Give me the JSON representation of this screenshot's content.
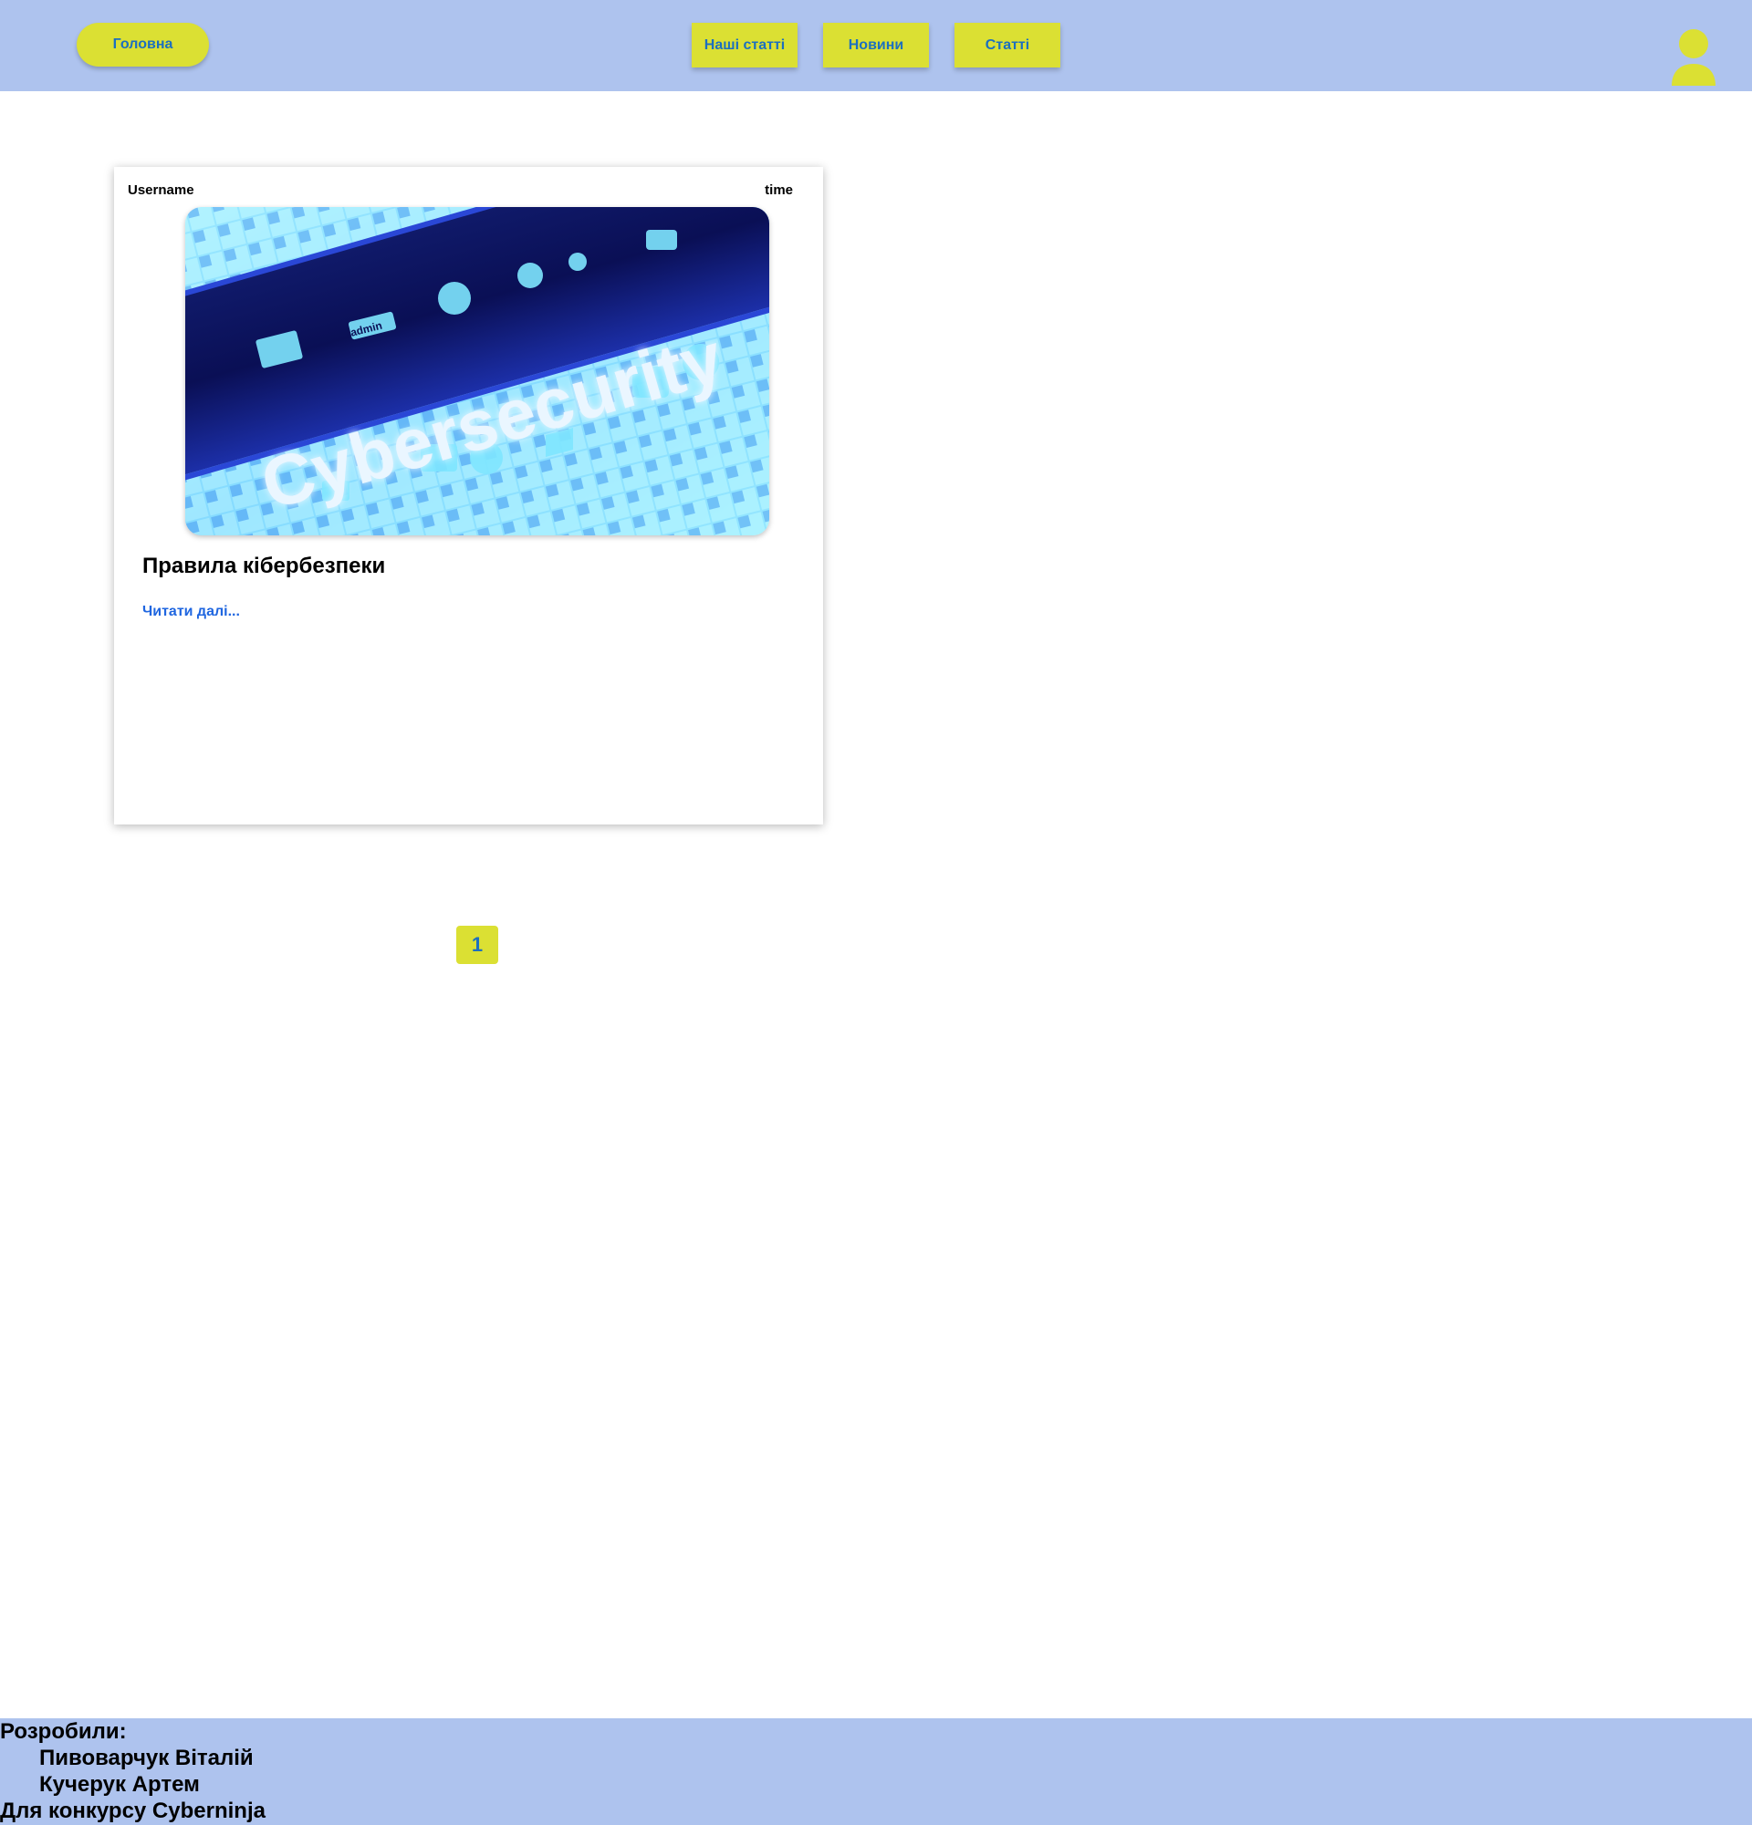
{
  "header": {
    "home_label": "Головна",
    "nav": [
      "Наші статті",
      "Новини",
      "Статті"
    ],
    "user_icon": "user-avatar-icon"
  },
  "article": {
    "username": "Username",
    "time": "time",
    "image_text": "Cybersecurity",
    "image_small_text": "admin",
    "title": "Правила кібербезпеки",
    "read_more": "Читати далі..."
  },
  "pagination": {
    "current_page": "1"
  },
  "footer": {
    "developed_by": "Розробили:",
    "authors": [
      "Пивоварчук Віталій",
      "Кучерук Артем"
    ],
    "contest": "Для конкурсу Cyberninja"
  },
  "colors": {
    "header_bg": "#aec3ee",
    "button_bg": "#dbe033",
    "button_text": "#1c6fbf",
    "link": "#1f66e0"
  }
}
